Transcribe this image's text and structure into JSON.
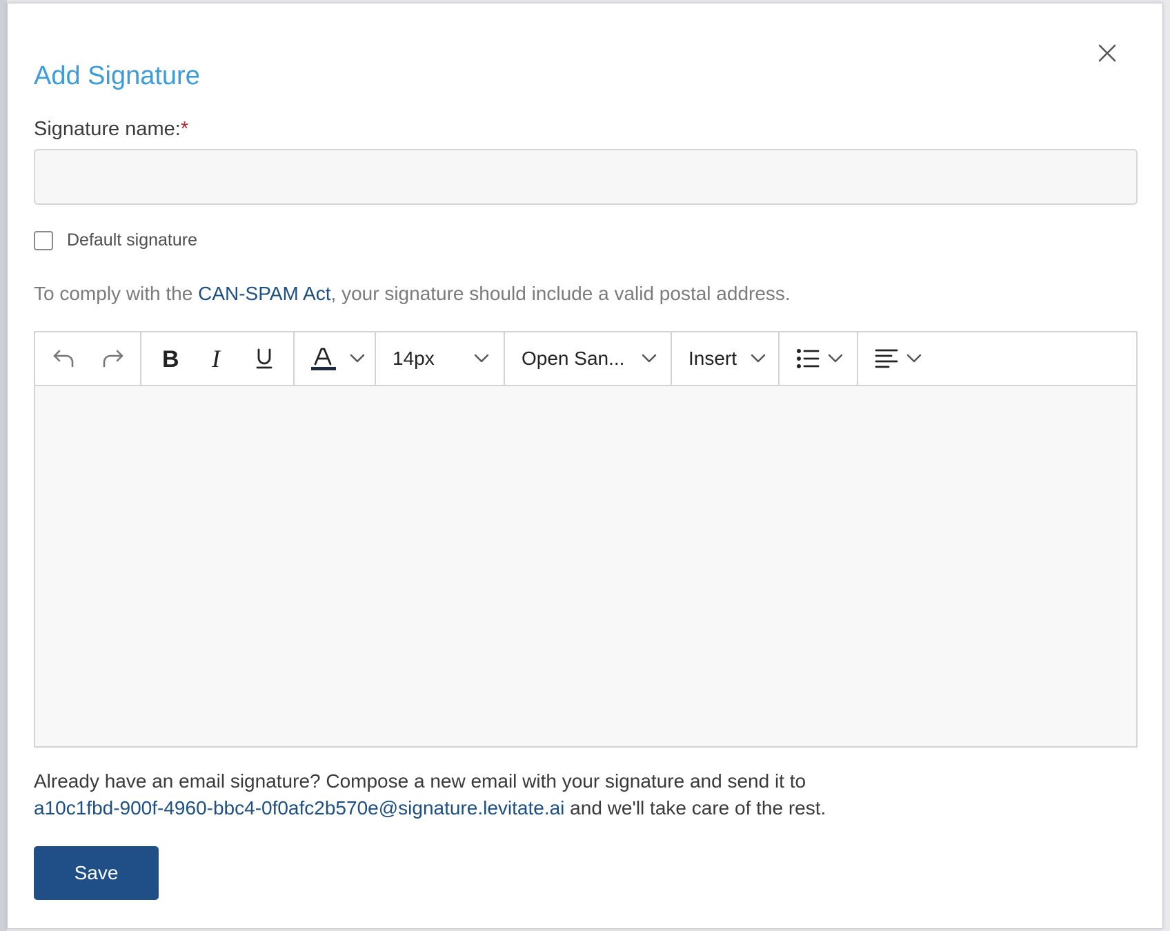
{
  "modal": {
    "title": "Add Signature",
    "name_label": "Signature name:",
    "required_mark": "*",
    "name_value": "",
    "name_placeholder": "",
    "default_checkbox_label": "Default signature",
    "default_checked": false,
    "comply_prefix": "To comply with the ",
    "comply_link": "CAN-SPAM Act",
    "comply_suffix": ", your signature should include a valid postal address."
  },
  "toolbar": {
    "font_size": "14px",
    "font_family": "Open San...",
    "insert_label": "Insert",
    "icons": {
      "undo": "undo-icon",
      "redo": "redo-icon",
      "bold": "bold-icon",
      "italic": "italic-icon",
      "underline": "underline-icon",
      "text_color": "text-color-icon",
      "list": "bulleted-list-icon",
      "align": "align-left-icon"
    }
  },
  "footer": {
    "line1": "Already have an email signature? Compose a new email with your signature and send it to",
    "email": "a10c1fbd-900f-4960-bbc4-0f0afc2b570e@signature.levitate.ai",
    "line2_suffix": " and we'll take care of the rest.",
    "save_label": "Save"
  },
  "colors": {
    "title": "#3d9bd6",
    "link": "#1e4f82",
    "primary_button": "#1f4f86",
    "required": "#c0282d"
  }
}
